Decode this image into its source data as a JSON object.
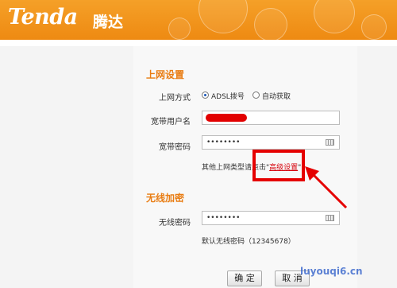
{
  "brand": {
    "logo_text": "Tenda",
    "logo_cn": "腾达"
  },
  "internet": {
    "title": "上网设置",
    "mode_label": "上网方式",
    "modes": [
      {
        "label": "ADSL拨号",
        "selected": true
      },
      {
        "label": "自动获取",
        "selected": false
      }
    ],
    "username_label": "宽带用户名",
    "password_label": "宽带密码",
    "password_value": "••••••••",
    "other_prefix": "其他上网类型请点击\"",
    "advanced_link": "高级设置",
    "other_suffix": "\""
  },
  "wireless": {
    "title": "无线加密",
    "password_label": "无线密码",
    "password_value": "••••••••",
    "default_hint": "默认无线密码（12345678）"
  },
  "buttons": {
    "confirm": "确 定",
    "cancel": "取 消"
  },
  "watermark": "luyouqi6.cn",
  "colors": {
    "accent": "#e97d13",
    "header": "#f39b22",
    "highlight": "#e50000"
  }
}
